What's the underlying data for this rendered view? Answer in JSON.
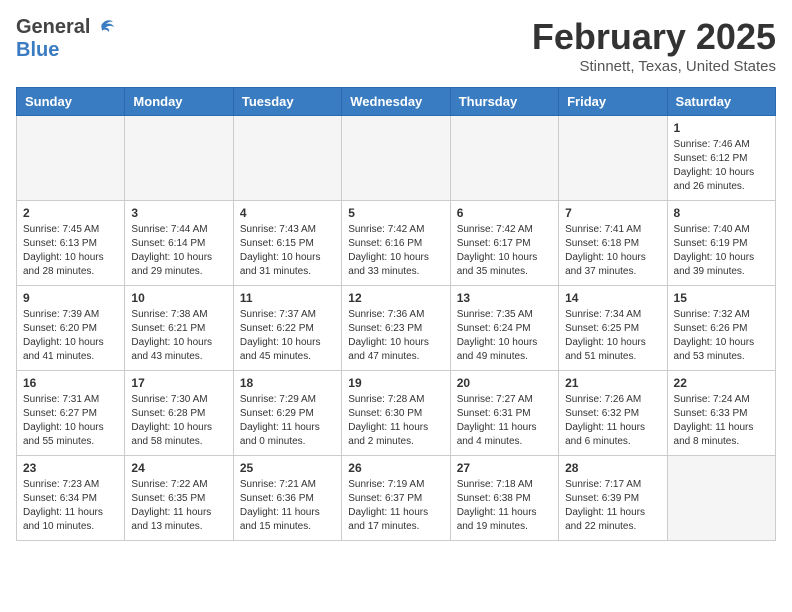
{
  "header": {
    "logo_line1": "General",
    "logo_line2": "Blue",
    "month": "February 2025",
    "location": "Stinnett, Texas, United States"
  },
  "calendar": {
    "days_of_week": [
      "Sunday",
      "Monday",
      "Tuesday",
      "Wednesday",
      "Thursday",
      "Friday",
      "Saturday"
    ],
    "weeks": [
      [
        {
          "day": "",
          "info": ""
        },
        {
          "day": "",
          "info": ""
        },
        {
          "day": "",
          "info": ""
        },
        {
          "day": "",
          "info": ""
        },
        {
          "day": "",
          "info": ""
        },
        {
          "day": "",
          "info": ""
        },
        {
          "day": "1",
          "info": "Sunrise: 7:46 AM\nSunset: 6:12 PM\nDaylight: 10 hours and 26 minutes."
        }
      ],
      [
        {
          "day": "2",
          "info": "Sunrise: 7:45 AM\nSunset: 6:13 PM\nDaylight: 10 hours and 28 minutes."
        },
        {
          "day": "3",
          "info": "Sunrise: 7:44 AM\nSunset: 6:14 PM\nDaylight: 10 hours and 29 minutes."
        },
        {
          "day": "4",
          "info": "Sunrise: 7:43 AM\nSunset: 6:15 PM\nDaylight: 10 hours and 31 minutes."
        },
        {
          "day": "5",
          "info": "Sunrise: 7:42 AM\nSunset: 6:16 PM\nDaylight: 10 hours and 33 minutes."
        },
        {
          "day": "6",
          "info": "Sunrise: 7:42 AM\nSunset: 6:17 PM\nDaylight: 10 hours and 35 minutes."
        },
        {
          "day": "7",
          "info": "Sunrise: 7:41 AM\nSunset: 6:18 PM\nDaylight: 10 hours and 37 minutes."
        },
        {
          "day": "8",
          "info": "Sunrise: 7:40 AM\nSunset: 6:19 PM\nDaylight: 10 hours and 39 minutes."
        }
      ],
      [
        {
          "day": "9",
          "info": "Sunrise: 7:39 AM\nSunset: 6:20 PM\nDaylight: 10 hours and 41 minutes."
        },
        {
          "day": "10",
          "info": "Sunrise: 7:38 AM\nSunset: 6:21 PM\nDaylight: 10 hours and 43 minutes."
        },
        {
          "day": "11",
          "info": "Sunrise: 7:37 AM\nSunset: 6:22 PM\nDaylight: 10 hours and 45 minutes."
        },
        {
          "day": "12",
          "info": "Sunrise: 7:36 AM\nSunset: 6:23 PM\nDaylight: 10 hours and 47 minutes."
        },
        {
          "day": "13",
          "info": "Sunrise: 7:35 AM\nSunset: 6:24 PM\nDaylight: 10 hours and 49 minutes."
        },
        {
          "day": "14",
          "info": "Sunrise: 7:34 AM\nSunset: 6:25 PM\nDaylight: 10 hours and 51 minutes."
        },
        {
          "day": "15",
          "info": "Sunrise: 7:32 AM\nSunset: 6:26 PM\nDaylight: 10 hours and 53 minutes."
        }
      ],
      [
        {
          "day": "16",
          "info": "Sunrise: 7:31 AM\nSunset: 6:27 PM\nDaylight: 10 hours and 55 minutes."
        },
        {
          "day": "17",
          "info": "Sunrise: 7:30 AM\nSunset: 6:28 PM\nDaylight: 10 hours and 58 minutes."
        },
        {
          "day": "18",
          "info": "Sunrise: 7:29 AM\nSunset: 6:29 PM\nDaylight: 11 hours and 0 minutes."
        },
        {
          "day": "19",
          "info": "Sunrise: 7:28 AM\nSunset: 6:30 PM\nDaylight: 11 hours and 2 minutes."
        },
        {
          "day": "20",
          "info": "Sunrise: 7:27 AM\nSunset: 6:31 PM\nDaylight: 11 hours and 4 minutes."
        },
        {
          "day": "21",
          "info": "Sunrise: 7:26 AM\nSunset: 6:32 PM\nDaylight: 11 hours and 6 minutes."
        },
        {
          "day": "22",
          "info": "Sunrise: 7:24 AM\nSunset: 6:33 PM\nDaylight: 11 hours and 8 minutes."
        }
      ],
      [
        {
          "day": "23",
          "info": "Sunrise: 7:23 AM\nSunset: 6:34 PM\nDaylight: 11 hours and 10 minutes."
        },
        {
          "day": "24",
          "info": "Sunrise: 7:22 AM\nSunset: 6:35 PM\nDaylight: 11 hours and 13 minutes."
        },
        {
          "day": "25",
          "info": "Sunrise: 7:21 AM\nSunset: 6:36 PM\nDaylight: 11 hours and 15 minutes."
        },
        {
          "day": "26",
          "info": "Sunrise: 7:19 AM\nSunset: 6:37 PM\nDaylight: 11 hours and 17 minutes."
        },
        {
          "day": "27",
          "info": "Sunrise: 7:18 AM\nSunset: 6:38 PM\nDaylight: 11 hours and 19 minutes."
        },
        {
          "day": "28",
          "info": "Sunrise: 7:17 AM\nSunset: 6:39 PM\nDaylight: 11 hours and 22 minutes."
        },
        {
          "day": "",
          "info": ""
        }
      ]
    ]
  }
}
